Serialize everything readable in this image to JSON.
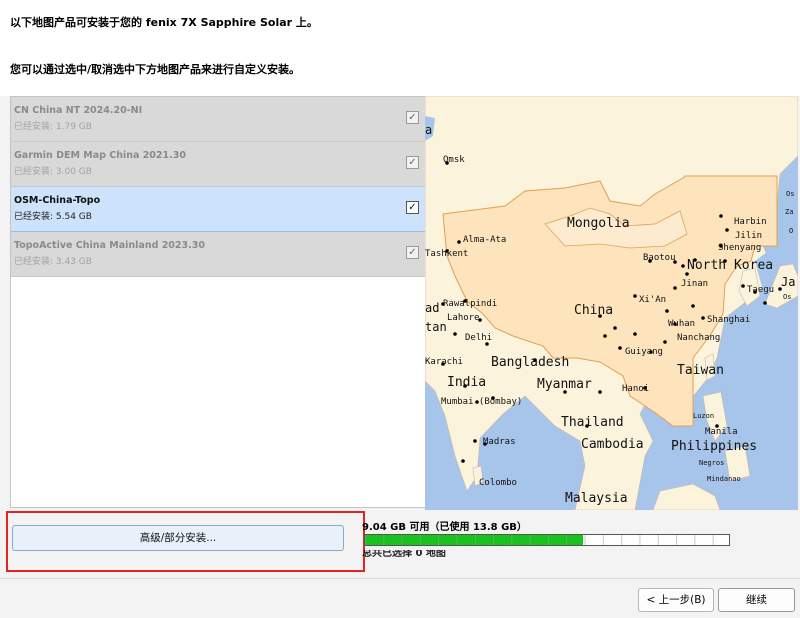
{
  "header": {
    "title": "以下地图产品可安装于您的 fenix 7X Sapphire Solar 上。",
    "instruction": "您可以通过选中/取消选中下方地图产品来进行自定义安装。"
  },
  "products": [
    {
      "name": "CN China NT 2024.20-NI",
      "size": "已经安装: 1.79 GB",
      "checked": true,
      "selected": false
    },
    {
      "name": "Garmin DEM Map China 2021.30",
      "size": "已经安装: 3.00 GB",
      "checked": true,
      "selected": false
    },
    {
      "name": "OSM-China-Topo",
      "size": "已经安装: 5.54 GB",
      "checked": true,
      "selected": true
    },
    {
      "name": "TopoActive China Mainland 2023.30",
      "size": "已经安装: 3.43 GB",
      "checked": true,
      "selected": false
    }
  ],
  "map": {
    "labels": {
      "omsk": "Omsk",
      "mongolia": "Mongolia",
      "harbin": "Harbin",
      "jilin": "Jilin",
      "shenyang": "Shenyang",
      "alma_ata": "Alma-Ata",
      "tashkent": "Tashkent",
      "baotou": "Baotou",
      "north_korea": "North Korea",
      "taegu": "Taegu",
      "jinan": "Jinan",
      "xian": "Xi'An",
      "china": "China",
      "rawalpindi": "Rawalpindi",
      "lahore": "Lahore",
      "shanghai": "Shanghai",
      "wuhan": "Wuhan",
      "nanchang": "Nanchang",
      "delhi": "Delhi",
      "guiyang": "Guiyang",
      "bangladesh": "Bangladesh",
      "karachi": "Karachi",
      "taiwan": "Taiwan",
      "india": "India",
      "myanmar": "Myanmar",
      "hanoi": "Hanoi",
      "mumbai": "Mumbai (Bombay)",
      "thailand": "Thailand",
      "luzon": "Luzon",
      "manila": "Manila",
      "madras": "Madras",
      "cambodia": "Cambodia",
      "philippines": "Philippines",
      "negros": "Negros",
      "mindanao": "Mindanao",
      "colombo": "Colombo",
      "malaysia": "Malaysia",
      "partial_a": "a",
      "partial_ja": "Ja",
      "partial_os": "Os",
      "partial_za": "Za",
      "partial_o": "O",
      "partial_tan": "tan",
      "partial_ad": "ad"
    },
    "colors": {
      "water": "#a7c5ea",
      "land": "#fbf3dc",
      "coverage": "#fde4bd",
      "coverage_border": "#e2a04f",
      "border": "#c9b6a9"
    }
  },
  "advanced_button": {
    "label": "高级/部分安装..."
  },
  "storage": {
    "text": "9.04 GB 可用（已使用 13.8 GB）",
    "used_fraction": 0.6,
    "selection_text": "总共已选择 0 地图"
  },
  "footer": {
    "back_label": "< 上一步(B)",
    "next_label": "继续"
  }
}
